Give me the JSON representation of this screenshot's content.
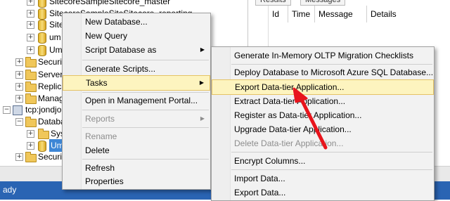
{
  "tree": {
    "rows": [
      {
        "label": "SitecoreSampleSitecore_master",
        "indent": 1,
        "icon": "database-icon"
      },
      {
        "label": "SitecoreSampleSiteSitecore_reporting",
        "indent": 1,
        "icon": "database-icon"
      },
      {
        "label": "Site",
        "indent": 1,
        "icon": "database-icon"
      },
      {
        "label": "um",
        "indent": 1,
        "icon": "database-icon"
      },
      {
        "label": "Um",
        "indent": 1,
        "icon": "database-icon"
      },
      {
        "label": "Securit",
        "indent": 0,
        "icon": "folder-icon"
      },
      {
        "label": "Server",
        "indent": 0,
        "icon": "folder-icon"
      },
      {
        "label": "Replica",
        "indent": 0,
        "icon": "folder-icon"
      },
      {
        "label": "Manag",
        "indent": 0,
        "icon": "folder-icon"
      },
      {
        "label": "tcp:jondjo",
        "indent": -1,
        "icon": "server-icon"
      },
      {
        "label": "Databa",
        "indent": 0,
        "icon": "folder-icon"
      },
      {
        "label": "Sys",
        "indent": 1,
        "icon": "folder-icon"
      },
      {
        "label": "Um",
        "indent": 1,
        "icon": "database-icon"
      },
      {
        "label": "Securit",
        "indent": 0,
        "icon": "folder-icon"
      }
    ]
  },
  "results": {
    "tabs": [
      "Results",
      "Messages"
    ],
    "columns": [
      "Id",
      "Time",
      "Message",
      "Details"
    ]
  },
  "status": {
    "text": "ady"
  },
  "menu1": {
    "items": [
      {
        "label": "New Database...",
        "disabled": false,
        "submenu": false
      },
      {
        "label": "New Query",
        "disabled": false,
        "submenu": false
      },
      {
        "label": "Script Database as",
        "disabled": false,
        "submenu": true
      },
      {
        "label": "Generate Scripts...",
        "disabled": false,
        "submenu": false
      },
      {
        "label": "Tasks",
        "disabled": false,
        "submenu": true
      },
      {
        "label": "Open in Management Portal...",
        "disabled": false,
        "submenu": false
      },
      {
        "label": "Reports",
        "disabled": true,
        "submenu": true
      },
      {
        "label": "Rename",
        "disabled": true,
        "submenu": false
      },
      {
        "label": "Delete",
        "disabled": false,
        "submenu": false
      },
      {
        "label": "Refresh",
        "disabled": false,
        "submenu": false
      },
      {
        "label": "Properties",
        "disabled": false,
        "submenu": false
      }
    ]
  },
  "menu2": {
    "items": [
      {
        "label": "Generate In-Memory OLTP Migration Checklists",
        "disabled": false
      },
      {
        "label": "Deploy Database to Microsoft Azure SQL Database...",
        "disabled": false
      },
      {
        "label": "Export Data-tier Application...",
        "disabled": false
      },
      {
        "label": "Extract Data-tier Application...",
        "disabled": false
      },
      {
        "label": "Register as Data-tier Application...",
        "disabled": false
      },
      {
        "label": "Upgrade Data-tier Application...",
        "disabled": false
      },
      {
        "label": "Delete Data-tier Application...",
        "disabled": true
      },
      {
        "label": "Encrypt Columns...",
        "disabled": false
      },
      {
        "label": "Import Data...",
        "disabled": false
      },
      {
        "label": "Export Data...",
        "disabled": false
      }
    ]
  },
  "colors": {
    "accent": "#2a64b3",
    "highlight": "#fdf4bf",
    "annotation": "#e8141c"
  }
}
